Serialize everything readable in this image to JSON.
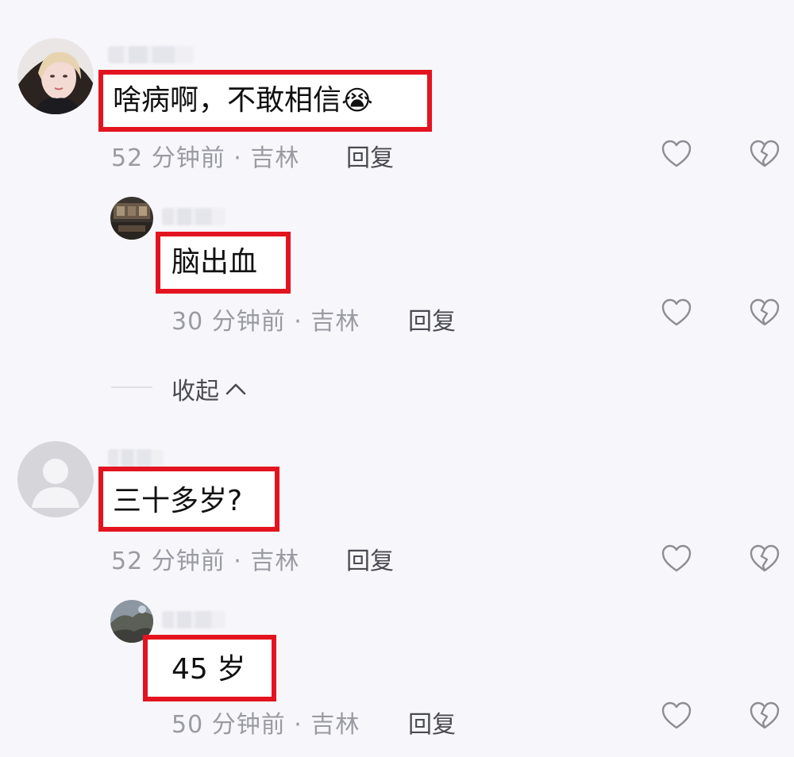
{
  "comments": [
    {
      "text": "啥病啊，不敢相信",
      "emoji": "😭",
      "time": "52 分钟前",
      "location": "吉林",
      "reply_label": "回复"
    },
    {
      "text": "脑出血",
      "time": "30 分钟前",
      "location": "吉林",
      "reply_label": "回复"
    },
    {
      "text": "三十多岁?",
      "time": "52 分钟前",
      "location": "吉林",
      "reply_label": "回复"
    },
    {
      "text": "45 岁",
      "time": "50 分钟前",
      "location": "吉林",
      "reply_label": "回复"
    }
  ],
  "collapse": {
    "label": "收起"
  },
  "meta_separator": "·",
  "icons": {
    "like": "heart-outline-icon",
    "dislike": "broken-heart-icon",
    "collapse": "chevron-up-icon"
  },
  "colors": {
    "highlight": "#e3141f",
    "meta_text": "#9a9aa3",
    "action_text": "#4a4a52",
    "background": "#f7f7fb"
  }
}
